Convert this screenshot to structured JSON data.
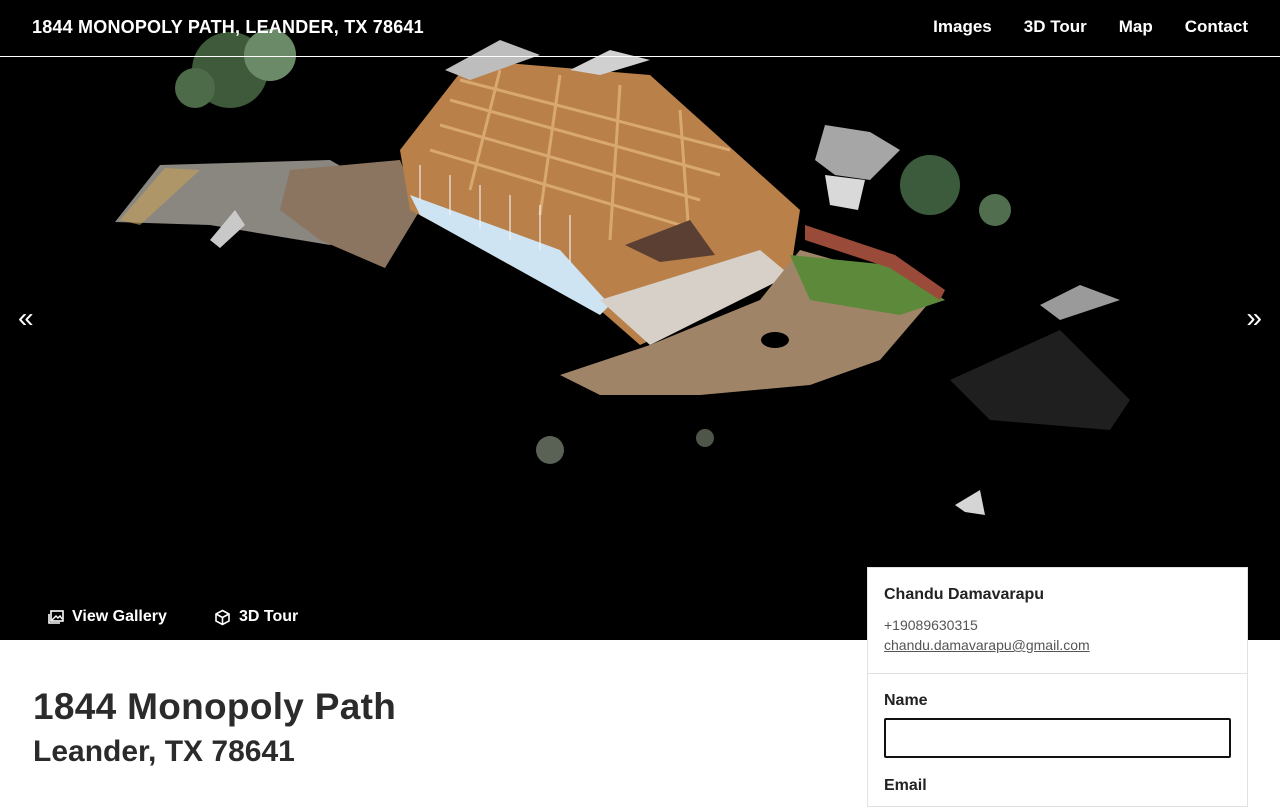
{
  "header": {
    "brand": "1844 MONOPOLY PATH, LEANDER, TX 78641",
    "nav": [
      "Images",
      "3D Tour",
      "Map",
      "Contact"
    ]
  },
  "hero": {
    "prev_glyph": "«",
    "next_glyph": "»",
    "buttons": {
      "gallery_label": "View Gallery",
      "gallery_icon": "gallery-icon",
      "tour_label": "3D Tour",
      "tour_icon": "cube-icon"
    }
  },
  "listing": {
    "title": "1844 Monopoly Path",
    "subtitle": "Leander, TX 78641"
  },
  "contact_card": {
    "agent_name": "Chandu Damavarapu",
    "phone": "+19089630315",
    "email": "chandu.damavarapu@gmail.com",
    "form": {
      "name_label": "Name",
      "name_value": "",
      "email_label": "Email"
    }
  }
}
